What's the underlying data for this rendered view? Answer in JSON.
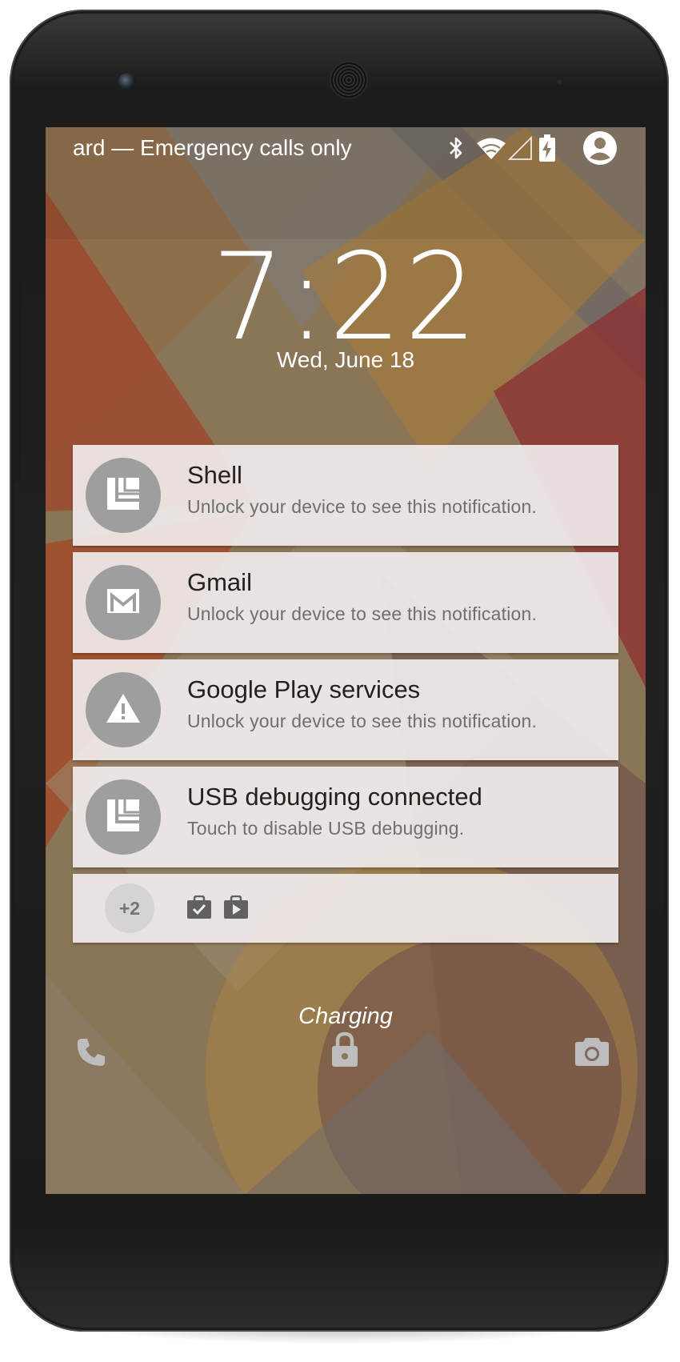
{
  "status_bar": {
    "carrier_text": "ard — Emergency calls only",
    "icons": [
      "bluetooth-icon",
      "wifi-icon",
      "cell-signal-icon",
      "battery-charging-icon",
      "user-avatar-icon"
    ]
  },
  "lockscreen": {
    "time": "7:22",
    "date": "Wed, June 18",
    "charging_label": "Charging"
  },
  "notifications": [
    {
      "app": "Shell",
      "text": "Unlock your device to see this notification.",
      "icon": "shell-icon"
    },
    {
      "app": "Gmail",
      "text": "Unlock your device to see this notification.",
      "icon": "gmail-icon"
    },
    {
      "app": "Google Play services",
      "text": "Unlock your device to see this notification.",
      "icon": "warning-icon"
    },
    {
      "app": "USB debugging connected",
      "text": "Touch to disable USB debugging.",
      "icon": "shell-icon"
    }
  ],
  "overflow": {
    "count_label": "+2",
    "icons": [
      "shopping-bag-check-icon",
      "play-store-bag-icon"
    ]
  },
  "affordances": {
    "left": "phone-icon",
    "center": "lock-icon",
    "right": "camera-icon"
  },
  "colors": {
    "notification_bg": "#F0ECEC",
    "icon_circle": "#9E9E9E",
    "title_text": "#212121",
    "body_text": "#6F6F6F"
  }
}
